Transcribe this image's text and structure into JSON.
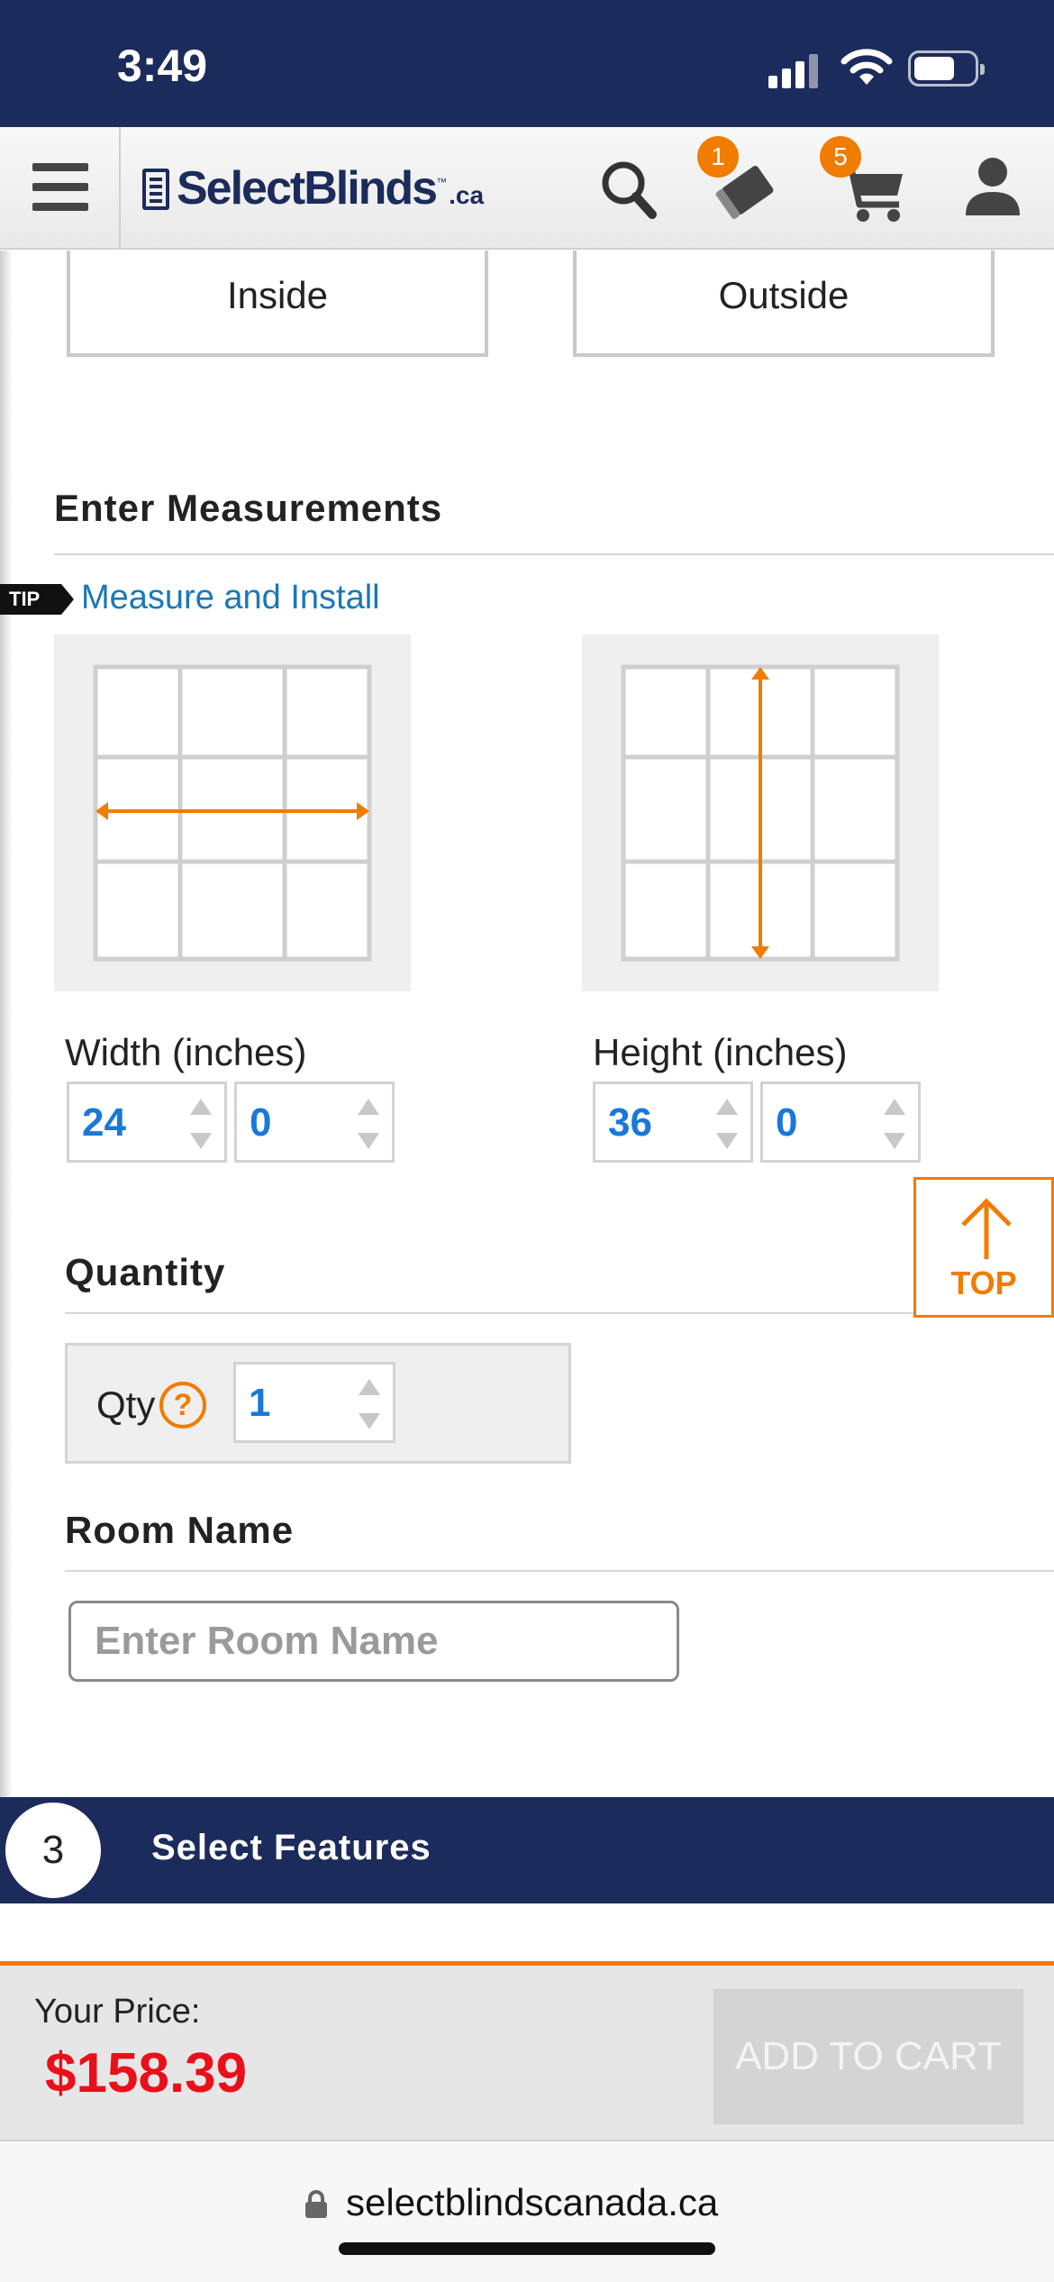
{
  "status_bar": {
    "time": "3:49"
  },
  "header": {
    "logo": {
      "text": "SelectBlinds",
      "tm": "™",
      "suffix": ".ca"
    },
    "swatch_count": "1",
    "cart_count": "5"
  },
  "mount": {
    "inside_label": "Inside",
    "outside_label": "Outside"
  },
  "measurements": {
    "title": "Enter Measurements",
    "tip_tag": "TIP",
    "tip_link": "Measure and Install",
    "width_label": "Width (inches)",
    "width_whole": "24",
    "width_fraction": "0",
    "height_label": "Height (inches)",
    "height_whole": "36",
    "height_fraction": "0"
  },
  "top_button": {
    "label": "TOP"
  },
  "quantity": {
    "title": "Quantity",
    "label": "Qty",
    "help": "?",
    "value": "1"
  },
  "room": {
    "title": "Room Name",
    "placeholder": "Enter Room Name"
  },
  "step": {
    "number": "3",
    "label": "Select Features"
  },
  "price": {
    "label": "Your Price:",
    "value": "$158.39"
  },
  "cart_button": {
    "label": "ADD TO CART"
  },
  "url_bar": {
    "url": "selectblindscanada.ca"
  },
  "colors": {
    "navy": "#1b2b5b",
    "orange": "#f07c00",
    "price_red": "#e8101a",
    "link_blue": "#1a78b8"
  }
}
